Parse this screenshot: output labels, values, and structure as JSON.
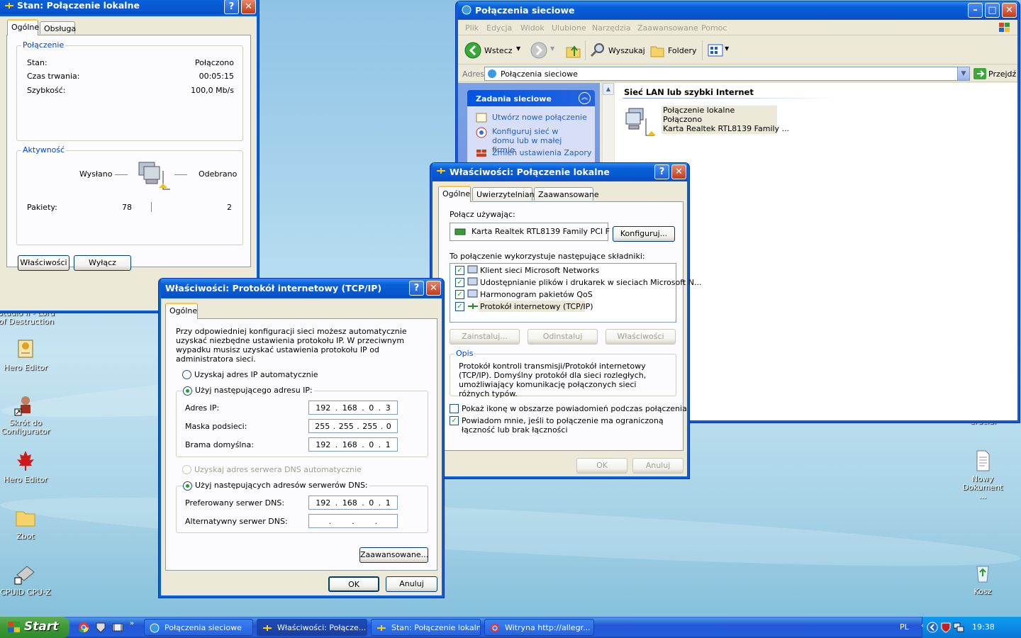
{
  "desktop": {
    "icons": [
      {
        "label": "Studio II - Lord of Destruction",
        "icon": "game-shortcut-icon"
      },
      {
        "label": "Hero Editor",
        "icon": "hero-editor-icon"
      },
      {
        "label": "Skrót do Configurator",
        "icon": "configurator-shortcut-icon"
      },
      {
        "label": "Hero Editor",
        "icon": "maple-leaf-icon"
      },
      {
        "label": "Zbot",
        "icon": "folder-icon"
      },
      {
        "label": "CPUID CPU-Z",
        "icon": "cpuz-icon"
      },
      {
        "label": "Nowy Dokument ...",
        "icon": "text-document-icon"
      },
      {
        "label": "Kosz",
        "icon": "recycle-bin-icon"
      },
      {
        "label": "Crucial",
        "icon": "desktop-item-icon"
      }
    ]
  },
  "status_window": {
    "title": "Stan: Połączenie lokalne",
    "tabs": [
      "Ogólne",
      "Obsługa"
    ],
    "connection": {
      "heading": "Połączenie",
      "rows": [
        {
          "label": "Stan:",
          "value": "Połączono"
        },
        {
          "label": "Czas trwania:",
          "value": "00:05:15"
        },
        {
          "label": "Szybkość:",
          "value": "100,0 Mb/s"
        }
      ]
    },
    "activity": {
      "heading": "Aktywność",
      "sent_label": "Wysłano",
      "received_label": "Odebrano",
      "packets_label": "Pakiety:",
      "packets_sent": "78",
      "packets_received": "2"
    },
    "buttons": {
      "properties": "Właściwości",
      "disable": "Wyłącz"
    }
  },
  "explorer": {
    "title": "Połączenia sieciowe",
    "menu": [
      "Plik",
      "Edycja",
      "Widok",
      "Ulubione",
      "Narzędzia",
      "Zaawansowane",
      "Pomoc"
    ],
    "toolbar": {
      "back": "Wstecz",
      "search": "Wyszukaj",
      "folders": "Foldery"
    },
    "address": {
      "label": "Adres",
      "value": "Połączenia sieciowe",
      "go": "Przejdź"
    },
    "tasks": {
      "heading": "Zadania sieciowe",
      "items": [
        "Utwórz nowe połączenie",
        "Konfiguruj sieć w domu lub w małej firmie",
        "Zmień ustawienia Zapory"
      ]
    },
    "group_heading": "Sieć LAN lub szybki Internet",
    "item": {
      "name": "Połączenie lokalne",
      "status": "Połączono",
      "device": "Karta Realtek RTL8139 Family ..."
    }
  },
  "props_window": {
    "title": "Właściwości: Połączenie lokalne",
    "tabs": [
      "Ogólne",
      "Uwierzytelnianie",
      "Zaawansowane"
    ],
    "connect_using_label": "Połącz używając:",
    "adapter": "Karta Realtek RTL8139 Family PCI F",
    "configure_button": "Konfiguruj...",
    "components_label": "To połączenie wykorzystuje następujące składniki:",
    "components": [
      "Klient sieci Microsoft Networks",
      "Udostępnianie plików i drukarek w sieciach Microsoft N...",
      "Harmonogram pakietów QoS",
      "Protokół internetowy (TCP/IP)"
    ],
    "buttons": {
      "install": "Zainstaluj...",
      "uninstall": "Odinstaluj",
      "properties": "Właściwości",
      "ok": "OK",
      "cancel": "Anuluj"
    },
    "description_heading": "Opis",
    "description": "Protokół kontroli transmisji/Protokół internetowy (TCP/IP). Domyślny protokół dla sieci rozległych, umożliwiający komunikację połączonych sieci różnych typów.",
    "show_icon": "Pokaż ikonę w obszarze powiadomień podczas połączenia",
    "notify": "Powiadom mnie, jeśli to połączenie ma ograniczoną łączność lub brak łączności"
  },
  "tcpip_window": {
    "title": "Właściwości: Protokół internetowy (TCP/IP)",
    "tab": "Ogólne",
    "intro": "Przy odpowiedniej konfiguracji sieci możesz automatycznie uzyskać niezbędne ustawienia protokołu IP. W przeciwnym wypadku musisz uzyskać ustawienia protokołu IP od administratora sieci.",
    "auto_ip": "Uzyskaj adres IP automatycznie",
    "manual_ip": "Użyj następującego adresu IP:",
    "ip_label": "Adres IP:",
    "ip": [
      "192",
      "168",
      "0",
      "3"
    ],
    "mask_label": "Maska podsieci:",
    "mask": [
      "255",
      "255",
      "255",
      "0"
    ],
    "gateway_label": "Brama domyślna:",
    "gateway": [
      "192",
      "168",
      "0",
      "1"
    ],
    "auto_dns": "Uzyskaj adres serwera DNS automatycznie",
    "manual_dns": "Użyj następujących adresów serwerów DNS:",
    "pref_dns_label": "Preferowany serwer DNS:",
    "pref_dns": [
      "192",
      "168",
      "0",
      "1"
    ],
    "alt_dns_label": "Alternatywny serwer DNS:",
    "alt_dns": [
      "",
      "",
      "",
      ""
    ],
    "advanced": "Zaawansowane...",
    "ok": "OK",
    "cancel": "Anuluj"
  },
  "taskbar": {
    "start": "Start",
    "tasks": [
      "Połączenia sieciowe",
      "Właściwości: Połącze...",
      "Stan: Połączenie lokalne",
      "Witryna http://allegr..."
    ],
    "lang": "PL",
    "clock": "19:38"
  },
  "colors": {
    "xp_blue": "#0a5fd8",
    "dialog_bg": "#ece9d8",
    "link": "#215dc6",
    "group_label": "#0046d5"
  }
}
